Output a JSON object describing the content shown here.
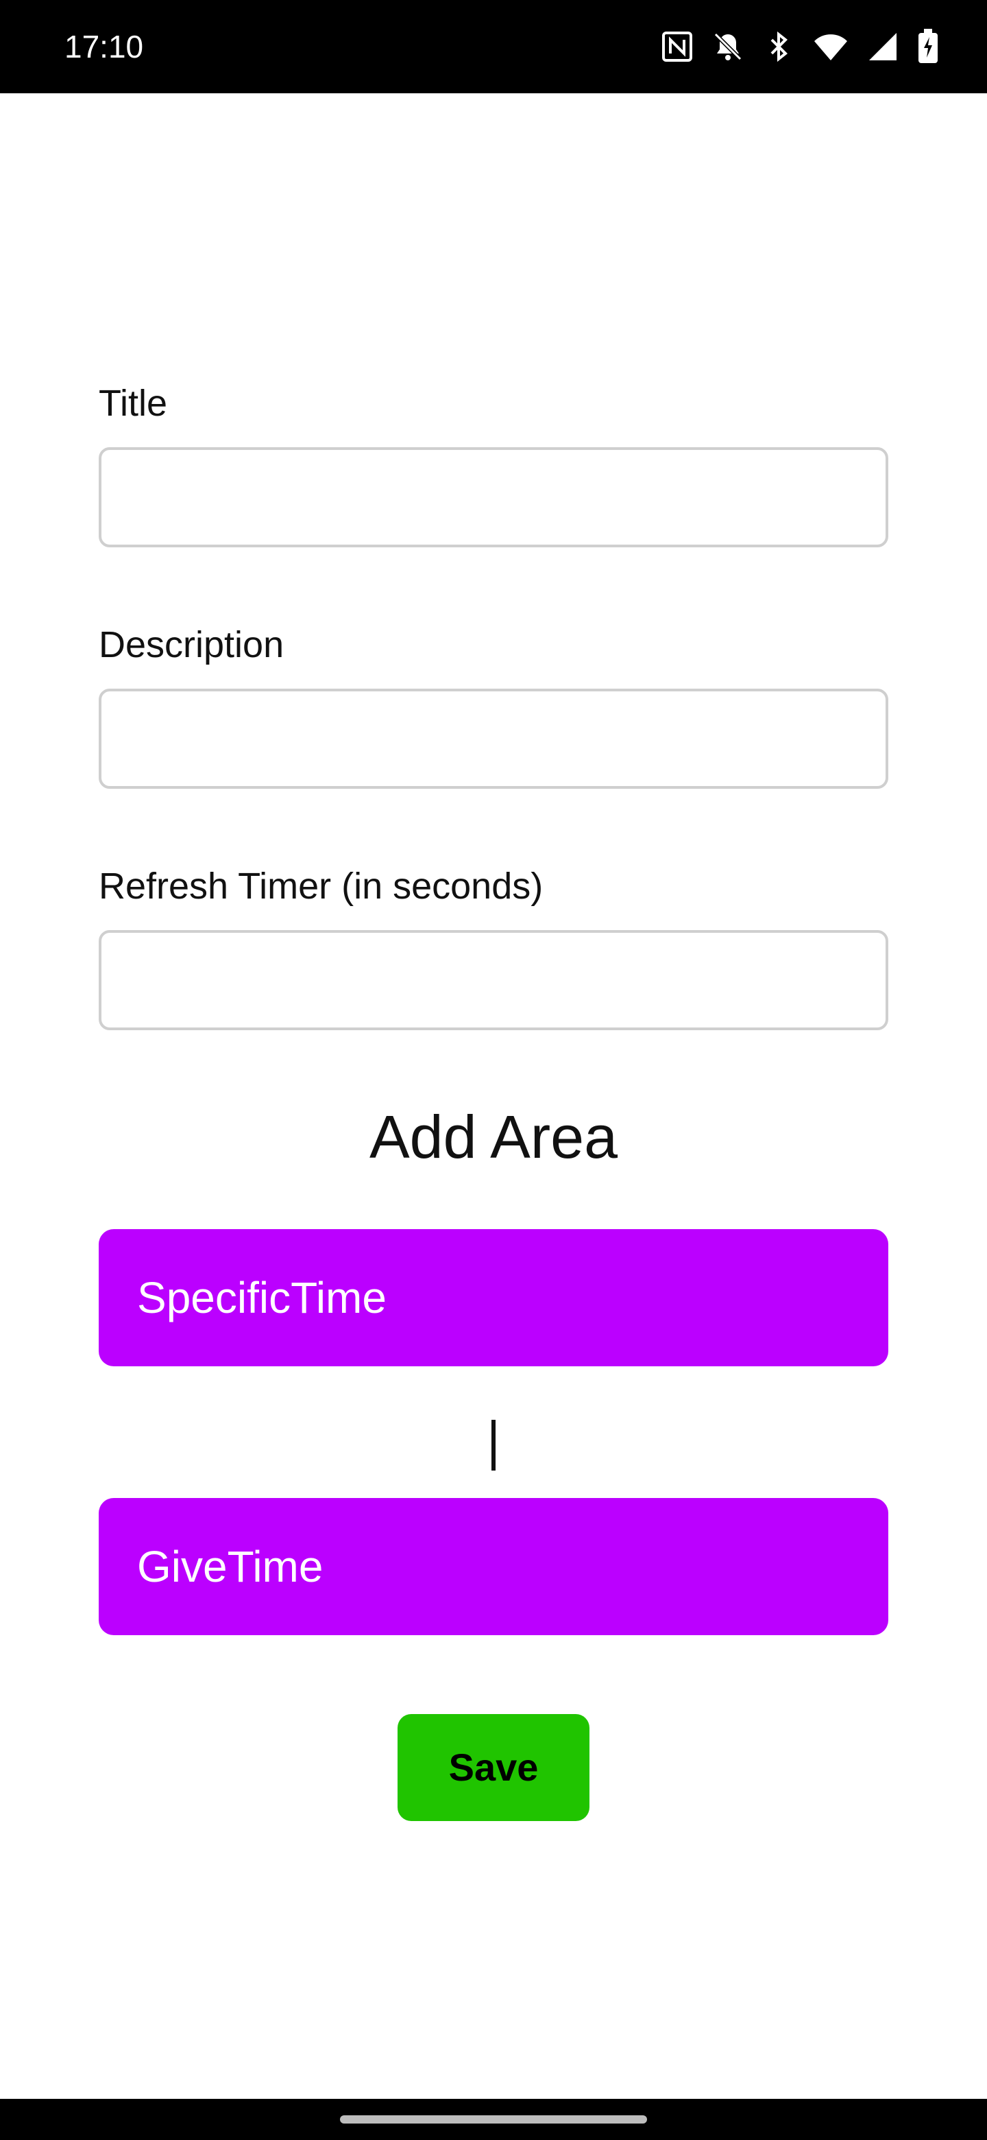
{
  "status_bar": {
    "time": "17:10",
    "icons": [
      "nfc-icon",
      "bell-off-icon",
      "bluetooth-icon",
      "wifi-icon",
      "signal-icon",
      "battery-charging-icon"
    ]
  },
  "form": {
    "title_label": "Title",
    "title_value": "",
    "description_label": "Description",
    "description_value": "",
    "refresh_label": "Refresh Timer (in seconds)",
    "refresh_value": ""
  },
  "add_area": {
    "title": "Add Area",
    "specific_time_label": "SpecificTime",
    "give_time_label": "GiveTime"
  },
  "save_label": "Save",
  "colors": {
    "area_button": "#bb00ff",
    "save_button": "#20c400"
  }
}
